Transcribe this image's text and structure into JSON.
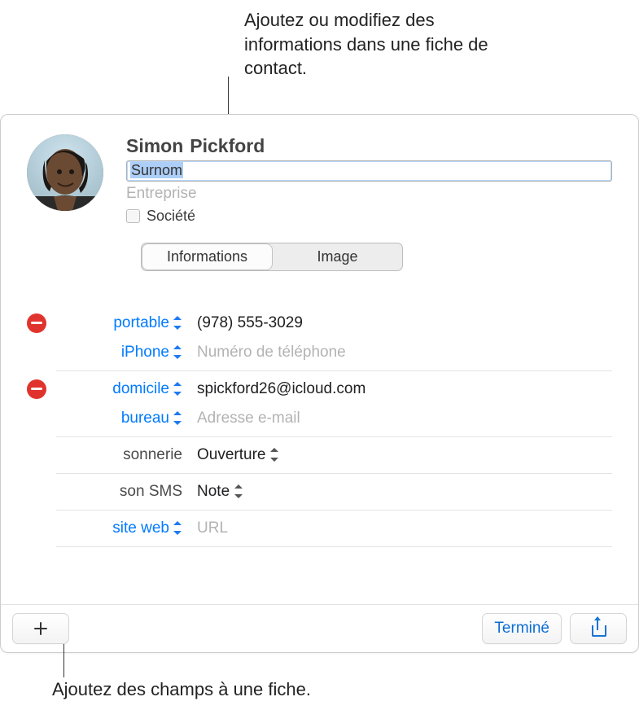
{
  "callouts": {
    "top": "Ajoutez ou modifiez des informations dans une fiche de contact.",
    "bottom": "Ajoutez des champs à une fiche."
  },
  "contact": {
    "first_name": "Simon",
    "last_name": "Pickford",
    "nickname": "Surnom",
    "company_placeholder": "Entreprise",
    "society_label": "Société"
  },
  "tabs": {
    "info": "Informations",
    "image": "Image"
  },
  "fields": {
    "phone_label": "portable",
    "phone_value": "(978) 555-3029",
    "phone2_label": "iPhone",
    "phone2_placeholder": "Numéro de téléphone",
    "email_label": "domicile",
    "email_value": "spickford26@icloud.com",
    "email2_label": "bureau",
    "email2_placeholder": "Adresse e-mail",
    "ringtone_label": "sonnerie",
    "ringtone_value": "Ouverture",
    "texttone_label": "son SMS",
    "texttone_value": "Note",
    "url_label": "site web",
    "url_placeholder": "URL"
  },
  "buttons": {
    "done": "Terminé"
  }
}
